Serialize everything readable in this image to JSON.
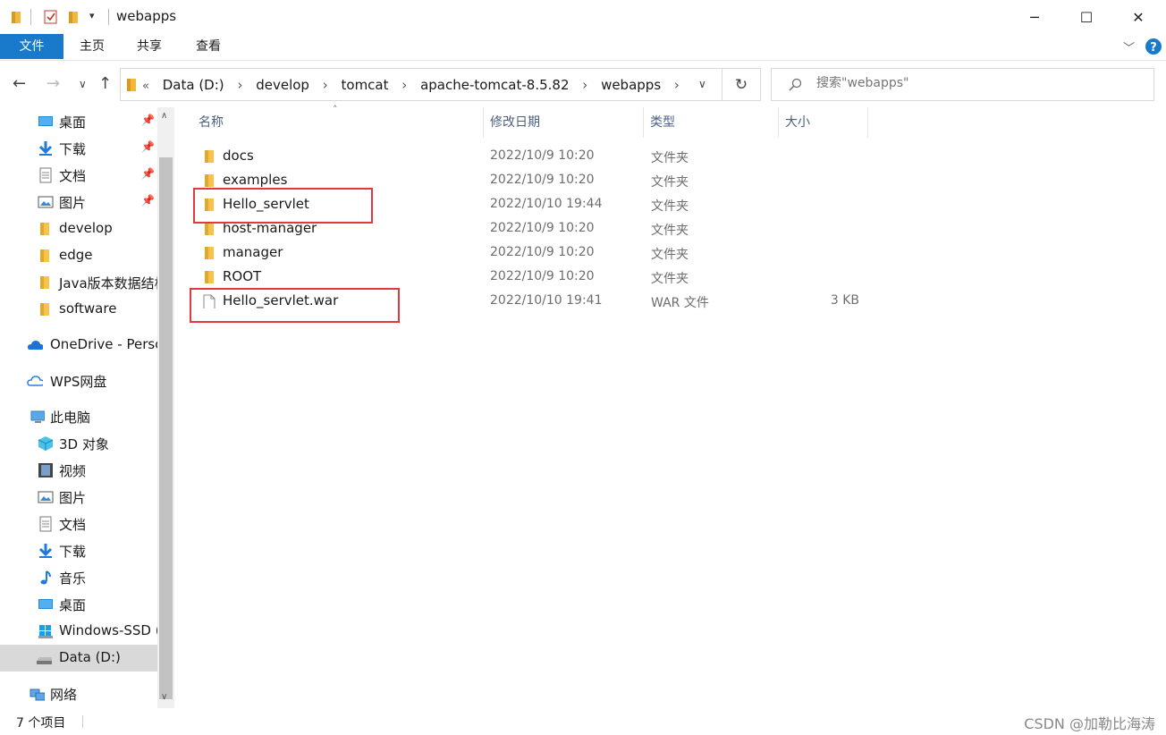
{
  "window": {
    "title": "webapps",
    "controls": {
      "minimize": "─",
      "maximize": "☐",
      "close": "✕"
    }
  },
  "ribbon": {
    "tabs": [
      {
        "label": "文件"
      },
      {
        "label": "主页"
      },
      {
        "label": "共享"
      },
      {
        "label": "查看"
      }
    ]
  },
  "address": {
    "prefix": "«",
    "crumbs": [
      "Data (D:)",
      "develop",
      "tomcat",
      "apache-tomcat-8.5.82",
      "webapps"
    ],
    "separator": "›"
  },
  "search": {
    "placeholder": "搜索\"webapps\""
  },
  "sidebar": {
    "items": [
      {
        "label": "桌面",
        "icon": "desktop-icon",
        "pinned": true
      },
      {
        "label": "下载",
        "icon": "download-icon",
        "pinned": true
      },
      {
        "label": "文档",
        "icon": "document-icon",
        "pinned": true
      },
      {
        "label": "图片",
        "icon": "pictures-icon",
        "pinned": true
      },
      {
        "label": "develop",
        "icon": "folder-icon"
      },
      {
        "label": "edge",
        "icon": "folder-icon"
      },
      {
        "label": "Java版本数据结构",
        "icon": "folder-icon"
      },
      {
        "label": "software",
        "icon": "folder-icon"
      },
      {
        "label": "OneDrive - Personal",
        "icon": "onedrive-icon"
      },
      {
        "label": "WPS网盘",
        "icon": "wps-cloud-icon"
      },
      {
        "label": "此电脑",
        "icon": "this-pc-icon"
      },
      {
        "label": "3D 对象",
        "icon": "3d-objects-icon"
      },
      {
        "label": "视频",
        "icon": "videos-icon"
      },
      {
        "label": "图片",
        "icon": "pictures-icon"
      },
      {
        "label": "文档",
        "icon": "document-icon"
      },
      {
        "label": "下载",
        "icon": "download-icon"
      },
      {
        "label": "音乐",
        "icon": "music-icon"
      },
      {
        "label": "桌面",
        "icon": "desktop-icon"
      },
      {
        "label": "Windows-SSD (C:)",
        "icon": "windows-drive-icon"
      },
      {
        "label": "Data (D:)",
        "icon": "drive-icon",
        "selected": true
      },
      {
        "label": "网络",
        "icon": "network-icon"
      }
    ]
  },
  "columns": {
    "name": "名称",
    "date": "修改日期",
    "type": "类型",
    "size": "大小"
  },
  "files": [
    {
      "name": "docs",
      "date": "2022/10/9 10:20",
      "type": "文件夹",
      "size": "",
      "kind": "folder"
    },
    {
      "name": "examples",
      "date": "2022/10/9 10:20",
      "type": "文件夹",
      "size": "",
      "kind": "folder"
    },
    {
      "name": "Hello_servlet",
      "date": "2022/10/10 19:44",
      "type": "文件夹",
      "size": "",
      "kind": "folder",
      "highlighted": true
    },
    {
      "name": "host-manager",
      "date": "2022/10/9 10:20",
      "type": "文件夹",
      "size": "",
      "kind": "folder"
    },
    {
      "name": "manager",
      "date": "2022/10/9 10:20",
      "type": "文件夹",
      "size": "",
      "kind": "folder"
    },
    {
      "name": "ROOT",
      "date": "2022/10/9 10:20",
      "type": "文件夹",
      "size": "",
      "kind": "folder"
    },
    {
      "name": "Hello_servlet.war",
      "date": "2022/10/10 19:41",
      "type": "WAR 文件",
      "size": "3 KB",
      "kind": "file",
      "highlighted": true
    }
  ],
  "status": {
    "item_count": "7 个项目"
  },
  "watermark": "CSDN @加勒比海涛",
  "colors": {
    "accent": "#1979ca",
    "highlight_box": "#e0393e",
    "folder": "#f8c34a"
  }
}
